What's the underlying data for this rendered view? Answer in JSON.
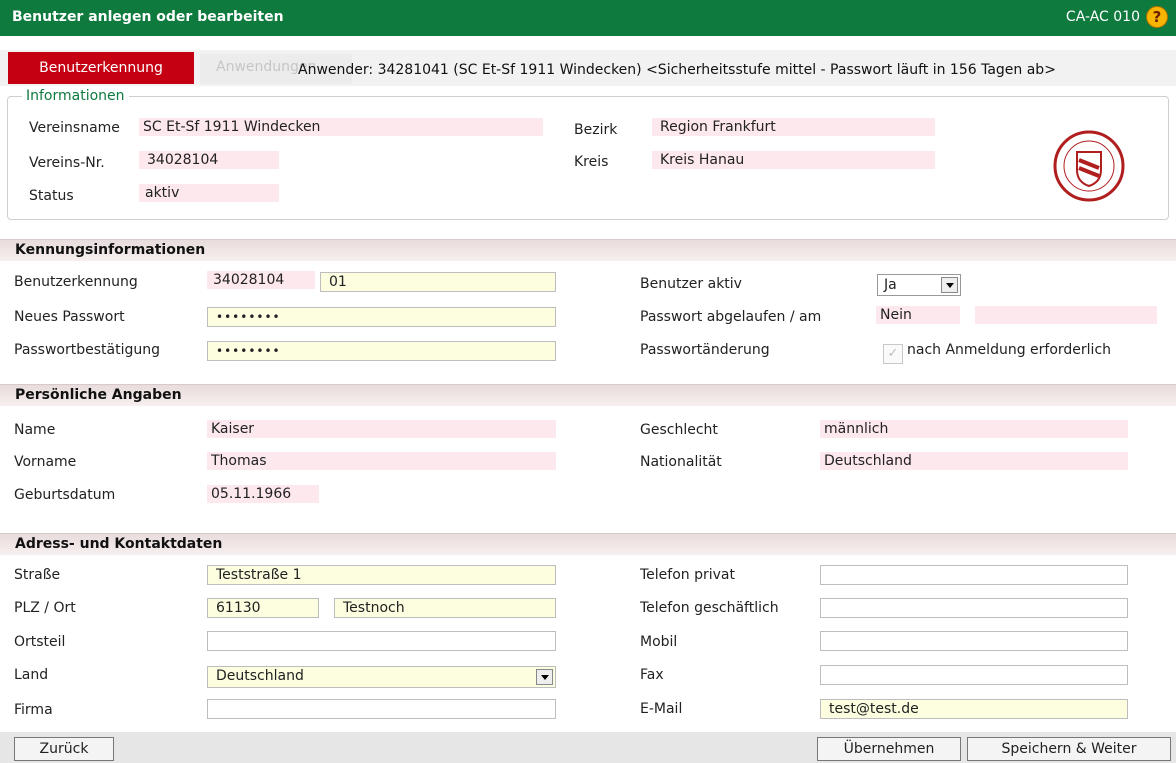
{
  "window": {
    "title": "Benutzer anlegen oder bearbeiten",
    "code": "CA-AC 010",
    "help": "?"
  },
  "tabs": [
    {
      "label": "Benutzerkennung",
      "active": true
    },
    {
      "label": "Anwendungen",
      "active": false
    }
  ],
  "user_info": "Anwender: 34281041 (SC Et-Sf 1911 Windecken) <Sicherheitsstufe mittel - Passwort läuft in 156 Tagen ab>",
  "informationen": {
    "legend": "Informationen",
    "vereinsname_label": "Vereinsname",
    "vereinsname": "SC Et-Sf 1911 Windecken",
    "vereinsnr_label": "Vereins-Nr.",
    "vereinsnr": "34028104",
    "status_label": "Status",
    "status": "aktiv",
    "bezirk_label": "Bezirk",
    "bezirk": "Region Frankfurt",
    "kreis_label": "Kreis",
    "kreis": "Kreis Hanau",
    "crest_icon": "club-crest-icon"
  },
  "kennung": {
    "heading": "Kennungsinformationen",
    "benutzerkennung_label": "Benutzerkennung",
    "benutzerkennung_prefix": "34028104",
    "benutzerkennung_suffix": "01",
    "neues_passwort_label": "Neues Passwort",
    "neues_passwort": "••••••••",
    "passwortbestaetigung_label": "Passwortbestätigung",
    "passwortbestaetigung": "••••••••",
    "benutzer_aktiv_label": "Benutzer aktiv",
    "benutzer_aktiv": "Ja",
    "passwort_abgelaufen_label": "Passwort abgelaufen / am",
    "passwort_abgelaufen": "Nein",
    "passwort_abgelaufen_am": "",
    "passwortaenderung_label": "Passwortänderung",
    "nach_anmeldung_label": "nach Anmeldung erforderlich"
  },
  "persoenlich": {
    "heading": "Persönliche Angaben",
    "name_label": "Name",
    "name": "Kaiser",
    "vorname_label": "Vorname",
    "vorname": "Thomas",
    "geburtsdatum_label": "Geburtsdatum",
    "geburtsdatum": "05.11.1966",
    "geschlecht_label": "Geschlecht",
    "geschlecht": "männlich",
    "nationalitaet_label": "Nationalität",
    "nationalitaet": "Deutschland"
  },
  "adresse": {
    "heading": "Adress- und Kontaktdaten",
    "strasse_label": "Straße",
    "strasse": "Teststraße 1",
    "plz_ort_label": "PLZ / Ort",
    "plz": "61130",
    "ort": "Testnoch",
    "ortsteil_label": "Ortsteil",
    "ortsteil": "",
    "land_label": "Land",
    "land": "Deutschland",
    "firma_label": "Firma",
    "firma": "",
    "telefon_privat_label": "Telefon privat",
    "telefon_privat": "",
    "telefon_geschaeftlich_label": "Telefon geschäftlich",
    "telefon_geschaeftlich": "",
    "mobil_label": "Mobil",
    "mobil": "",
    "fax_label": "Fax",
    "fax": "",
    "email_label": "E-Mail",
    "email": "test@test.de"
  },
  "buttons": {
    "zurueck": "Zurück",
    "uebernehmen": "Übernehmen",
    "speichern_weiter": "Speichern & Weiter"
  }
}
